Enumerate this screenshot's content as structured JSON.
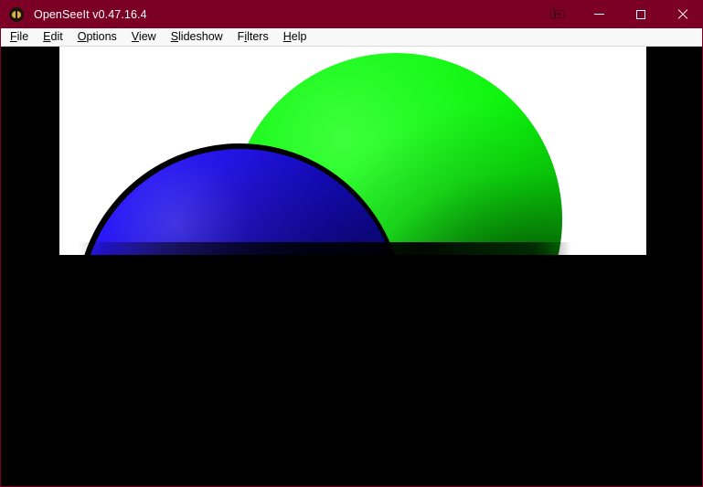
{
  "window": {
    "title": "OpenSeeIt v0.47.16.4",
    "app_icon": "butterfly-eye-icon",
    "titlebar_color": "#7c0026",
    "controls": {
      "secondary_display": "dual-screen-icon",
      "minimize": "minimize-icon",
      "maximize": "maximize-icon",
      "close": "close-icon"
    }
  },
  "menu": {
    "items": [
      {
        "label": "File",
        "pre": "",
        "accel": "F",
        "post": "ile"
      },
      {
        "label": "Edit",
        "pre": "",
        "accel": "E",
        "post": "dit"
      },
      {
        "label": "Options",
        "pre": "",
        "accel": "O",
        "post": "ptions"
      },
      {
        "label": "View",
        "pre": "",
        "accel": "V",
        "post": "iew"
      },
      {
        "label": "Slideshow",
        "pre": "",
        "accel": "S",
        "post": "lideshow"
      },
      {
        "label": "Filters",
        "pre": "F",
        "accel": "i",
        "post": "lters"
      },
      {
        "label": "Help",
        "pre": "",
        "accel": "H",
        "post": "elp"
      }
    ]
  },
  "viewer": {
    "background_color": "#000000",
    "image": {
      "canvas_background": "#ffffff",
      "objects": [
        {
          "name": "green-sphere",
          "color": "#10f010",
          "highlight_color": "#3dff3d",
          "shadow_color": "#015401"
        },
        {
          "name": "blue-sphere",
          "color": "#1a0ef5",
          "highlight_color": "#4a3cff",
          "shadow_color": "#050247"
        },
        {
          "name": "ground-plane",
          "color": "#000000"
        }
      ]
    }
  }
}
